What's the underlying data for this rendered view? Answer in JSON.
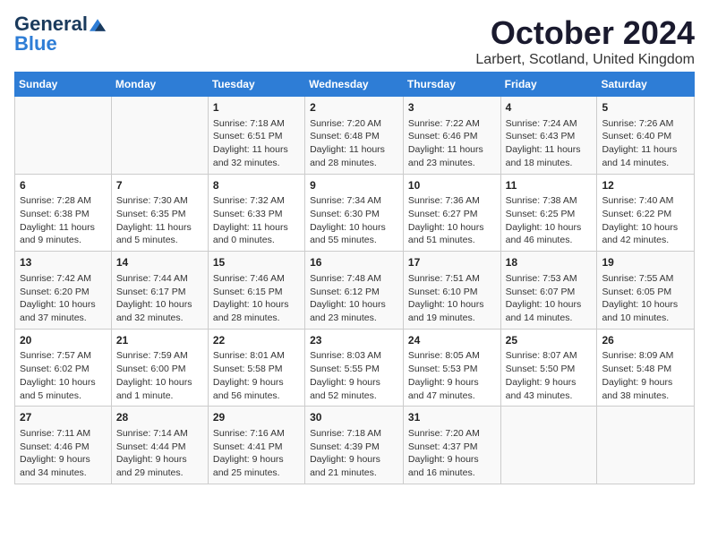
{
  "header": {
    "logo_line1": "General",
    "logo_line2": "Blue",
    "title": "October 2024",
    "subtitle": "Larbert, Scotland, United Kingdom"
  },
  "days_of_week": [
    "Sunday",
    "Monday",
    "Tuesday",
    "Wednesday",
    "Thursday",
    "Friday",
    "Saturday"
  ],
  "weeks": [
    [
      {
        "day": "",
        "info": ""
      },
      {
        "day": "",
        "info": ""
      },
      {
        "day": "1",
        "info": "Sunrise: 7:18 AM\nSunset: 6:51 PM\nDaylight: 11 hours\nand 32 minutes."
      },
      {
        "day": "2",
        "info": "Sunrise: 7:20 AM\nSunset: 6:48 PM\nDaylight: 11 hours\nand 28 minutes."
      },
      {
        "day": "3",
        "info": "Sunrise: 7:22 AM\nSunset: 6:46 PM\nDaylight: 11 hours\nand 23 minutes."
      },
      {
        "day": "4",
        "info": "Sunrise: 7:24 AM\nSunset: 6:43 PM\nDaylight: 11 hours\nand 18 minutes."
      },
      {
        "day": "5",
        "info": "Sunrise: 7:26 AM\nSunset: 6:40 PM\nDaylight: 11 hours\nand 14 minutes."
      }
    ],
    [
      {
        "day": "6",
        "info": "Sunrise: 7:28 AM\nSunset: 6:38 PM\nDaylight: 11 hours\nand 9 minutes."
      },
      {
        "day": "7",
        "info": "Sunrise: 7:30 AM\nSunset: 6:35 PM\nDaylight: 11 hours\nand 5 minutes."
      },
      {
        "day": "8",
        "info": "Sunrise: 7:32 AM\nSunset: 6:33 PM\nDaylight: 11 hours\nand 0 minutes."
      },
      {
        "day": "9",
        "info": "Sunrise: 7:34 AM\nSunset: 6:30 PM\nDaylight: 10 hours\nand 55 minutes."
      },
      {
        "day": "10",
        "info": "Sunrise: 7:36 AM\nSunset: 6:27 PM\nDaylight: 10 hours\nand 51 minutes."
      },
      {
        "day": "11",
        "info": "Sunrise: 7:38 AM\nSunset: 6:25 PM\nDaylight: 10 hours\nand 46 minutes."
      },
      {
        "day": "12",
        "info": "Sunrise: 7:40 AM\nSunset: 6:22 PM\nDaylight: 10 hours\nand 42 minutes."
      }
    ],
    [
      {
        "day": "13",
        "info": "Sunrise: 7:42 AM\nSunset: 6:20 PM\nDaylight: 10 hours\nand 37 minutes."
      },
      {
        "day": "14",
        "info": "Sunrise: 7:44 AM\nSunset: 6:17 PM\nDaylight: 10 hours\nand 32 minutes."
      },
      {
        "day": "15",
        "info": "Sunrise: 7:46 AM\nSunset: 6:15 PM\nDaylight: 10 hours\nand 28 minutes."
      },
      {
        "day": "16",
        "info": "Sunrise: 7:48 AM\nSunset: 6:12 PM\nDaylight: 10 hours\nand 23 minutes."
      },
      {
        "day": "17",
        "info": "Sunrise: 7:51 AM\nSunset: 6:10 PM\nDaylight: 10 hours\nand 19 minutes."
      },
      {
        "day": "18",
        "info": "Sunrise: 7:53 AM\nSunset: 6:07 PM\nDaylight: 10 hours\nand 14 minutes."
      },
      {
        "day": "19",
        "info": "Sunrise: 7:55 AM\nSunset: 6:05 PM\nDaylight: 10 hours\nand 10 minutes."
      }
    ],
    [
      {
        "day": "20",
        "info": "Sunrise: 7:57 AM\nSunset: 6:02 PM\nDaylight: 10 hours\nand 5 minutes."
      },
      {
        "day": "21",
        "info": "Sunrise: 7:59 AM\nSunset: 6:00 PM\nDaylight: 10 hours\nand 1 minute."
      },
      {
        "day": "22",
        "info": "Sunrise: 8:01 AM\nSunset: 5:58 PM\nDaylight: 9 hours\nand 56 minutes."
      },
      {
        "day": "23",
        "info": "Sunrise: 8:03 AM\nSunset: 5:55 PM\nDaylight: 9 hours\nand 52 minutes."
      },
      {
        "day": "24",
        "info": "Sunrise: 8:05 AM\nSunset: 5:53 PM\nDaylight: 9 hours\nand 47 minutes."
      },
      {
        "day": "25",
        "info": "Sunrise: 8:07 AM\nSunset: 5:50 PM\nDaylight: 9 hours\nand 43 minutes."
      },
      {
        "day": "26",
        "info": "Sunrise: 8:09 AM\nSunset: 5:48 PM\nDaylight: 9 hours\nand 38 minutes."
      }
    ],
    [
      {
        "day": "27",
        "info": "Sunrise: 7:11 AM\nSunset: 4:46 PM\nDaylight: 9 hours\nand 34 minutes."
      },
      {
        "day": "28",
        "info": "Sunrise: 7:14 AM\nSunset: 4:44 PM\nDaylight: 9 hours\nand 29 minutes."
      },
      {
        "day": "29",
        "info": "Sunrise: 7:16 AM\nSunset: 4:41 PM\nDaylight: 9 hours\nand 25 minutes."
      },
      {
        "day": "30",
        "info": "Sunrise: 7:18 AM\nSunset: 4:39 PM\nDaylight: 9 hours\nand 21 minutes."
      },
      {
        "day": "31",
        "info": "Sunrise: 7:20 AM\nSunset: 4:37 PM\nDaylight: 9 hours\nand 16 minutes."
      },
      {
        "day": "",
        "info": ""
      },
      {
        "day": "",
        "info": ""
      }
    ]
  ]
}
